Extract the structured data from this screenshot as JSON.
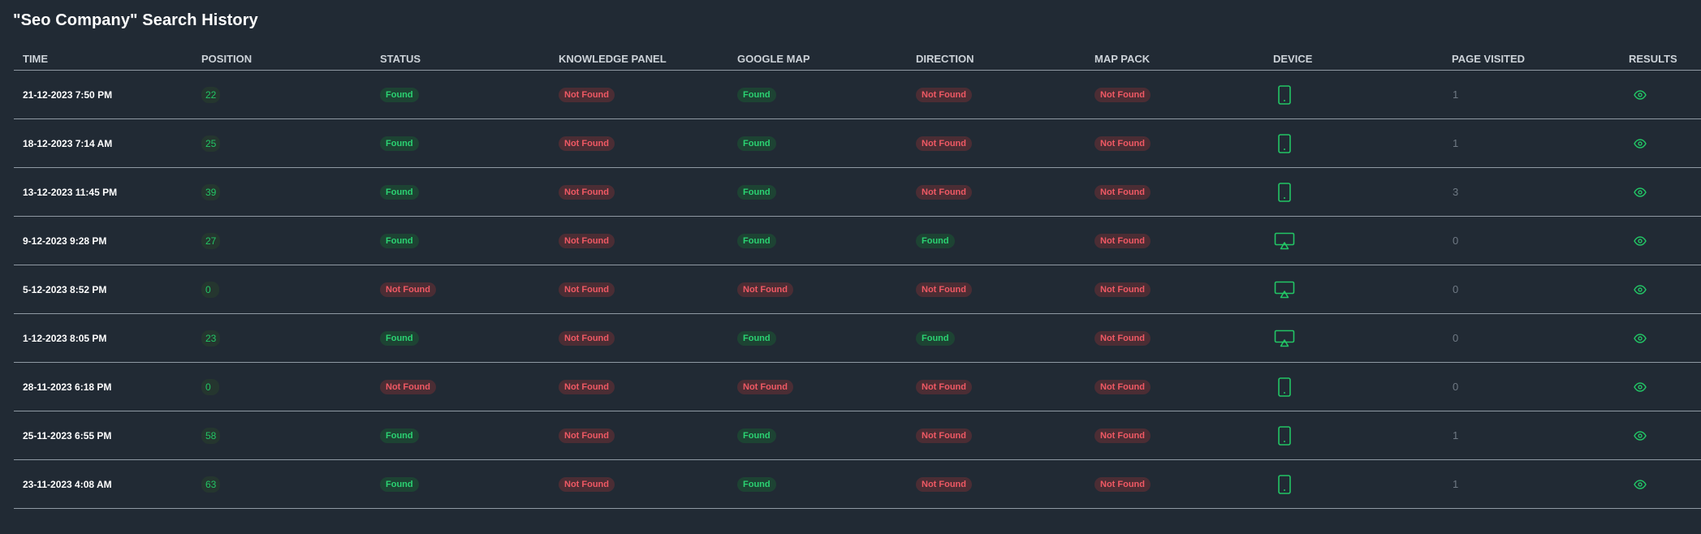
{
  "page": {
    "title": "\"Seo Company\" Search History"
  },
  "colors": {
    "background": "#212a34",
    "found_text": "#2bd272",
    "found_bg": "#1d4333",
    "not_found_text": "#ef5964",
    "not_found_bg": "#4b2d34",
    "icon_green": "#22c565"
  },
  "table": {
    "headers": [
      "TIME",
      "POSITION",
      "STATUS",
      "KNOWLEDGE PANEL",
      "GOOGLE MAP",
      "DIRECTION",
      "MAP PACK",
      "DEVICE",
      "PAGE VISITED",
      "RESULTS"
    ],
    "rows": [
      {
        "time": "21-12-2023 7:50 PM",
        "position": "22",
        "status": "Found",
        "knowledge_panel": "Not Found",
        "google_map": "Found",
        "direction": "Not Found",
        "map_pack": "Not Found",
        "device": "mobile-icon",
        "page_visited": "1",
        "results": "eye-icon"
      },
      {
        "time": "18-12-2023 7:14 AM",
        "position": "25",
        "status": "Found",
        "knowledge_panel": "Not Found",
        "google_map": "Found",
        "direction": "Not Found",
        "map_pack": "Not Found",
        "device": "mobile-icon",
        "page_visited": "1",
        "results": "eye-icon"
      },
      {
        "time": "13-12-2023 11:45 PM",
        "position": "39",
        "status": "Found",
        "knowledge_panel": "Not Found",
        "google_map": "Found",
        "direction": "Not Found",
        "map_pack": "Not Found",
        "device": "mobile-icon",
        "page_visited": "3",
        "results": "eye-icon"
      },
      {
        "time": "9-12-2023 9:28 PM",
        "position": "27",
        "status": "Found",
        "knowledge_panel": "Not Found",
        "google_map": "Found",
        "direction": "Found",
        "map_pack": "Not Found",
        "device": "desktop-icon",
        "page_visited": "0",
        "results": "eye-icon"
      },
      {
        "time": "5-12-2023 8:52 PM",
        "position": "0",
        "status": "Not Found",
        "knowledge_panel": "Not Found",
        "google_map": "Not Found",
        "direction": "Not Found",
        "map_pack": "Not Found",
        "device": "desktop-icon",
        "page_visited": "0",
        "results": "eye-icon"
      },
      {
        "time": "1-12-2023 8:05 PM",
        "position": "23",
        "status": "Found",
        "knowledge_panel": "Not Found",
        "google_map": "Found",
        "direction": "Found",
        "map_pack": "Not Found",
        "device": "desktop-icon",
        "page_visited": "0",
        "results": "eye-icon"
      },
      {
        "time": "28-11-2023 6:18 PM",
        "position": "0",
        "status": "Not Found",
        "knowledge_panel": "Not Found",
        "google_map": "Not Found",
        "direction": "Not Found",
        "map_pack": "Not Found",
        "device": "mobile-icon",
        "page_visited": "0",
        "results": "eye-icon"
      },
      {
        "time": "25-11-2023 6:55 PM",
        "position": "58",
        "status": "Found",
        "knowledge_panel": "Not Found",
        "google_map": "Found",
        "direction": "Not Found",
        "map_pack": "Not Found",
        "device": "mobile-icon",
        "page_visited": "1",
        "results": "eye-icon"
      },
      {
        "time": "23-11-2023 4:08 AM",
        "position": "63",
        "status": "Found",
        "knowledge_panel": "Not Found",
        "google_map": "Found",
        "direction": "Not Found",
        "map_pack": "Not Found",
        "device": "mobile-icon",
        "page_visited": "1",
        "results": "eye-icon"
      }
    ]
  }
}
